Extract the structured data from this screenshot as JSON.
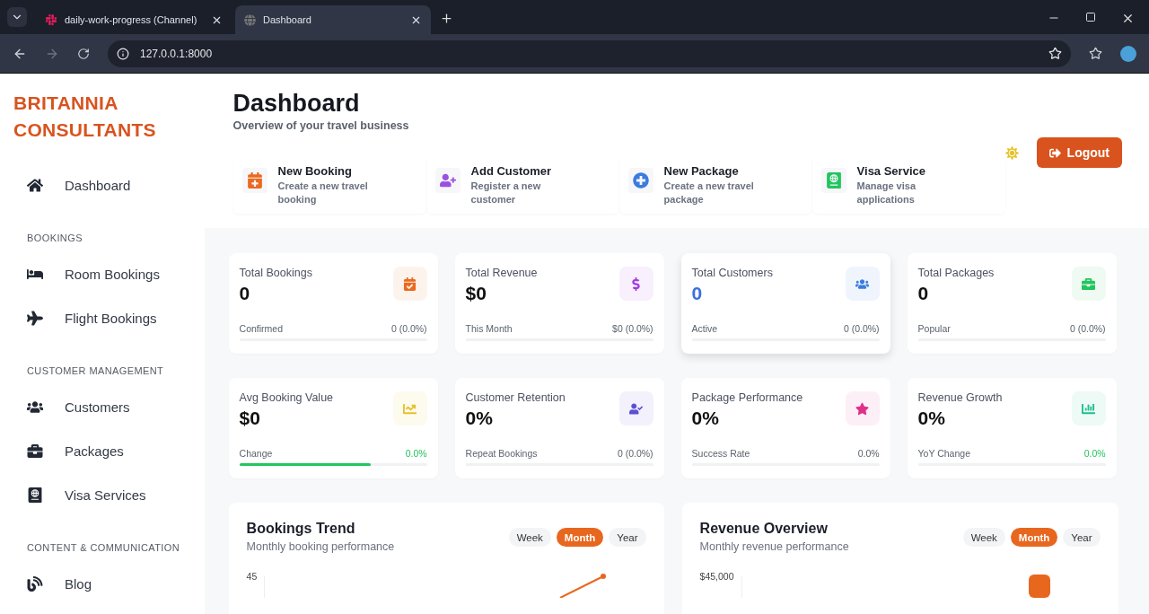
{
  "browser": {
    "tabs": [
      {
        "title": "daily-work-progress (Channel)",
        "selected": false
      },
      {
        "title": "Dashboard",
        "selected": true
      }
    ],
    "address": "127.0.0.1:8000"
  },
  "sidebar": {
    "brand": [
      "BRITANNIA",
      "CONSULTANTS"
    ],
    "sections": [
      {
        "items": [
          {
            "label": "Dashboard",
            "selected": false
          }
        ]
      },
      {
        "heading": "BOOKINGS",
        "items": [
          {
            "label": "Room Bookings",
            "selected": false
          },
          {
            "label": "Flight Bookings",
            "selected": false
          }
        ]
      },
      {
        "heading": "CUSTOMER MANAGEMENT",
        "items": [
          {
            "label": "Customers",
            "selected": false
          },
          {
            "label": "Packages",
            "selected": false
          },
          {
            "label": "Visa Services",
            "selected": false
          }
        ]
      },
      {
        "heading": "CONTENT & COMMUNICATION",
        "items": [
          {
            "label": "Blog",
            "selected": false
          }
        ]
      }
    ]
  },
  "header": {
    "title": "Dashboard",
    "subtitle": "Overview of your travel business",
    "logout": "Logout"
  },
  "quick_actions": [
    {
      "title": "New Booking",
      "description": "Create a new travel booking"
    },
    {
      "title": "Add Customer",
      "description": "Register a new customer"
    },
    {
      "title": "New Package",
      "description": "Create a new travel package"
    },
    {
      "title": "Visa Service",
      "description": "Manage visa applications"
    }
  ],
  "stats": [
    {
      "title": "Total Bookings",
      "value": "0",
      "color": "#ea6a1f",
      "footer_label": "Confirmed",
      "footer_value": "0 (0.0%)",
      "positive": false,
      "hovered": false
    },
    {
      "title": "Total Revenue",
      "value": "$0",
      "color": "#a43be0",
      "footer_label": "This Month",
      "footer_value": "$0 (0.0%)",
      "positive": false,
      "hovered": false
    },
    {
      "title": "Total Customers",
      "value": "0",
      "color": "#3b7be0",
      "footer_label": "Active",
      "footer_value": "0 (0.0%)",
      "positive": false,
      "hovered": true
    },
    {
      "title": "Total Packages",
      "value": "0",
      "color": "#22c55e",
      "footer_label": "Popular",
      "footer_value": "0 (0.0%)",
      "positive": false,
      "hovered": false
    },
    {
      "title": "Avg Booking Value",
      "value": "$0",
      "color": "#e6c229",
      "footer_label": "Change",
      "footer_value": "0.0%",
      "positive": true,
      "hovered": false,
      "level": 0.7
    },
    {
      "title": "Customer Retention",
      "value": "0%",
      "color": "#5b4fd6",
      "footer_label": "Repeat Bookings",
      "footer_value": "0 (0.0%)",
      "positive": false,
      "hovered": false
    },
    {
      "title": "Package Performance",
      "value": "0%",
      "color": "#e0308a",
      "footer_label": "Success Rate",
      "footer_value": "0.0%",
      "positive": false,
      "hovered": false
    },
    {
      "title": "Revenue Growth",
      "value": "0%",
      "color": "#1fbf8f",
      "footer_label": "YoY Change",
      "footer_value": "0.0%",
      "positive": true,
      "hovered": false
    }
  ],
  "charts": [
    {
      "kind": "line",
      "title": "Bookings Trend",
      "subtitle": "Monthly booking performance",
      "periods": [
        {
          "label": "Week",
          "selected": false
        },
        {
          "label": "Month",
          "selected": true
        },
        {
          "label": "Year",
          "selected": false
        }
      ],
      "top_tick": "45"
    },
    {
      "kind": "bar",
      "title": "Revenue Overview",
      "subtitle": "Monthly revenue performance",
      "periods": [
        {
          "label": "Week",
          "selected": false
        },
        {
          "label": "Month",
          "selected": true
        },
        {
          "label": "Year",
          "selected": false
        }
      ],
      "top_tick": "$45,000"
    }
  ]
}
